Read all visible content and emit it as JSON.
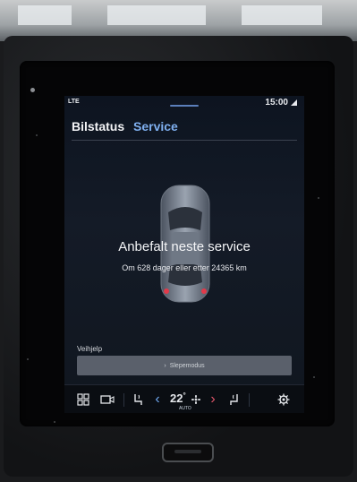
{
  "status_bar": {
    "network": "LTE",
    "time": "15:00"
  },
  "tabs": [
    {
      "label": "Bilstatus"
    },
    {
      "label": "Service"
    }
  ],
  "service": {
    "title": "Anbefalt neste service",
    "subtitle": "Om 628 dager eller etter 24365 km"
  },
  "help": {
    "label": "Veihjelp",
    "row_label": "Slepemodus"
  },
  "climate": {
    "temperature": "22",
    "degree": "°",
    "fan_mode": "AUTO"
  },
  "colors": {
    "accent": "#7fb0f0",
    "screen_bg": "#10161f"
  },
  "icons": [
    "grid-icon",
    "camera-icon",
    "seat-heat-icon",
    "chevron-left-icon",
    "fan-icon",
    "chevron-right-icon",
    "seat-heat-right-icon",
    "settings-icon"
  ]
}
